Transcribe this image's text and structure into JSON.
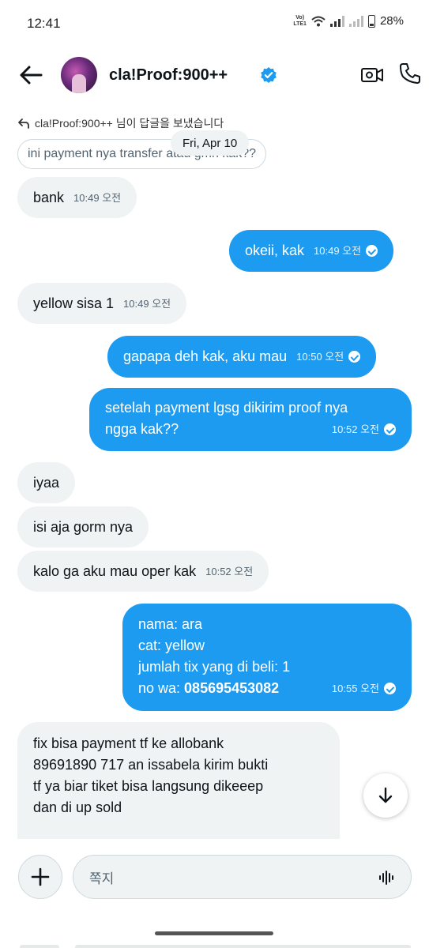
{
  "status_bar": {
    "time": "12:41",
    "network": "VoLTE1",
    "battery": "28%"
  },
  "header": {
    "contact_name": "cla!Proof:900++"
  },
  "reply": {
    "context": "cla!Proof:900++ 님이 답글을 보냈습니다",
    "quoted_text": "ini payment nya transfer atau gmn kak??"
  },
  "date_separator": "Fri, Apr 10",
  "messages": [
    {
      "text": "bank",
      "time": "10:49 오전"
    },
    {
      "text": "okeii, kak",
      "time": "10:49 오전"
    },
    {
      "text": "yellow sisa 1",
      "time": "10:49 오전"
    },
    {
      "text": "gapapa deh kak, aku mau",
      "time": "10:50 오전"
    },
    {
      "lines": [
        "setelah payment lgsg dikirim proof nya",
        "ngga kak??"
      ],
      "time": "10:52 오전"
    },
    {
      "text": "iyaa"
    },
    {
      "text": "isi aja gorm nya"
    },
    {
      "text": "kalo ga aku mau oper kak",
      "time": "10:52 오전"
    },
    {
      "lines": [
        "nama: ara",
        "cat: yellow",
        "jumlah tix yang di beli: 1"
      ],
      "label": "no wa: ",
      "value": "085695453082",
      "time": "10:55 오전"
    },
    {
      "lines": [
        "fix bisa payment  tf  ke allobank",
        "89691890 717 an issabela   kirim bukti",
        "tf ya biar tiket bisa langsung dikeeep",
        "dan di up sold"
      ]
    }
  ],
  "composer": {
    "placeholder": "쪽지"
  }
}
